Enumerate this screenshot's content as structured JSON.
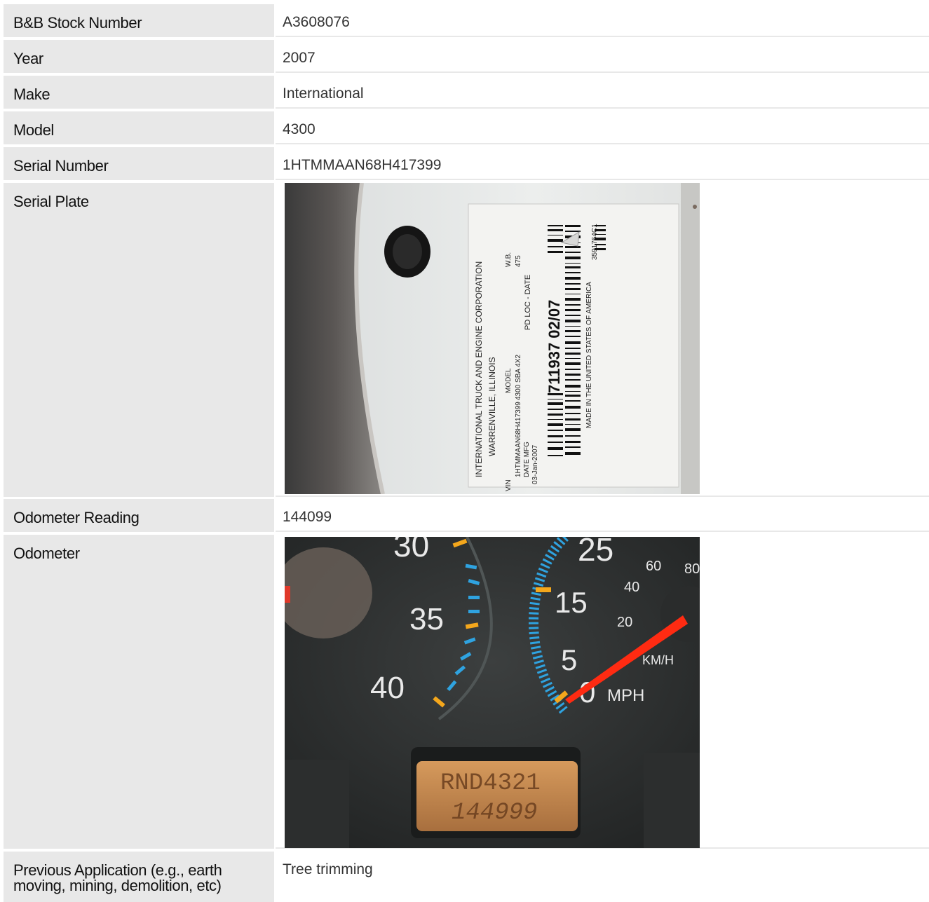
{
  "rows": [
    {
      "label": "B&B Stock Number",
      "value": "A3608076"
    },
    {
      "label": "Year",
      "value": "2007"
    },
    {
      "label": "Make",
      "value": "International"
    },
    {
      "label": "Model",
      "value": "4300"
    },
    {
      "label": "Serial Number",
      "value": "1HTMMAAN68H417399"
    },
    {
      "label": "Serial Plate",
      "value": ""
    },
    {
      "label": "Odometer Reading",
      "value": "144099"
    },
    {
      "label": "Odometer",
      "value": ""
    },
    {
      "label": "Previous Application (e.g., earth moving, mining, demolition, etc)",
      "value": "Tree trimming"
    }
  ],
  "serial_plate": {
    "l1": "INTERNATIONAL TRUCK AND ENGINE CORPORATION",
    "l2": "WARRENVILLE, ILLINOIS",
    "vin_label": "VIN",
    "vin": "1HTMMAAN68H417399",
    "model_label": "MODEL",
    "model": "4300 SBA 4X2",
    "wb_label": "W.B.",
    "wb": "475",
    "date_mfg_label": "DATE MFG",
    "date_mfg": "03-Jan-2007",
    "pd_label": "PD LOC - DATE",
    "pd": "711937 02/07",
    "made": "MADE IN THE UNITED STATES OF AMERICA",
    "part": "3591764C1"
  },
  "odometer": {
    "tach_labels": [
      "30",
      "35",
      "40"
    ],
    "speed_labels": [
      "25",
      "15",
      "5",
      "0"
    ],
    "kmh_labels": [
      "60",
      "80",
      "40",
      "20"
    ],
    "unit_kmh": "KM/H",
    "unit_mph": "MPH",
    "lcd_top": "RND4321",
    "lcd_bottom": "144999",
    "colors": {
      "amber": "#f4a71c",
      "blue": "#2fa3e0",
      "needle": "#ff2b12",
      "lcd": "#c98a4e"
    }
  }
}
